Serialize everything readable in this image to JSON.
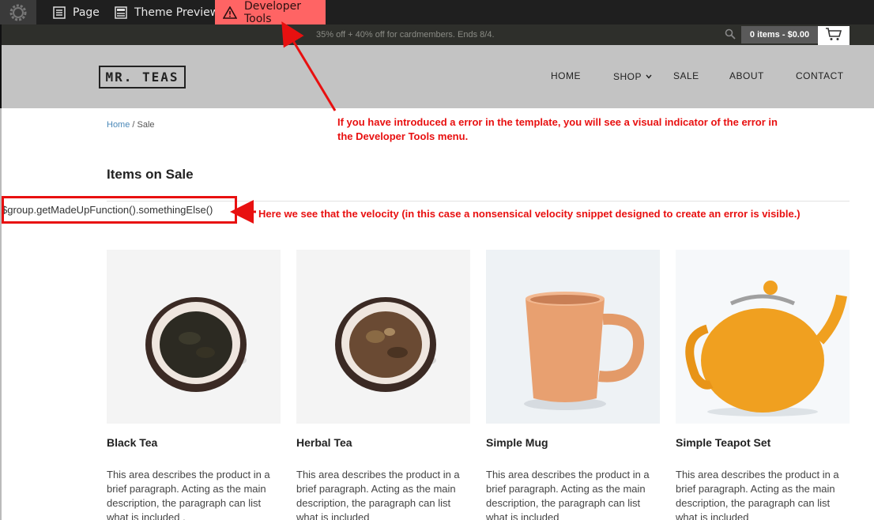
{
  "admin_bar": {
    "items": [
      {
        "label": "Page",
        "icon": "page-icon"
      },
      {
        "label": "Theme Preview",
        "icon": "theme-preview-icon"
      },
      {
        "label": "Developer Tools",
        "icon": "warning-icon"
      }
    ],
    "dev_tools_color": "#ff6464"
  },
  "promo": {
    "text": "35% off + 40% off for cardmembers. Ends 8/4.",
    "cart_label": "0 items - $0.00"
  },
  "header": {
    "logo": "MR. TEAS",
    "nav": [
      "HOME",
      "SHOP",
      "SALE",
      "ABOUT",
      "CONTACT"
    ]
  },
  "breadcrumb": {
    "home": "Home",
    "separator": "/",
    "current": "Sale"
  },
  "page_title": "Items on Sale",
  "velocity_snippet": "$group.getMadeUpFunction().somethingElse()",
  "annotations": {
    "error_indicator": "If you have introduced a error in the template, you will see a visual indicator of the error in the Developer Tools menu.",
    "velocity_visible": "Here we see that the velocity (in this case a nonsensical velocity snippet designed to create an error is visible.)",
    "color": "#e81010"
  },
  "products": [
    {
      "name": "Black Tea",
      "description": "This area describes the product in a brief paragraph. Acting as the main description, the paragraph can list what is included ."
    },
    {
      "name": "Herbal Tea",
      "description": "This area describes the product in a brief paragraph. Acting as the main description, the paragraph can list what is included"
    },
    {
      "name": "Simple Mug",
      "description": "This area describes the product in a brief paragraph. Acting as the main description, the paragraph can list what is included"
    },
    {
      "name": "Simple Teapot Set",
      "description": "This area describes the product in a brief paragraph. Acting as the main description, the paragraph can list what is included"
    }
  ]
}
